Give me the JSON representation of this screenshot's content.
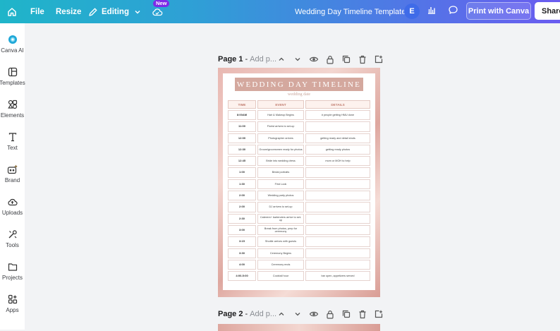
{
  "topbar": {
    "file_label": "File",
    "resize_label": "Resize",
    "editing_label": "Editing",
    "new_badge": "New",
    "doc_title": "Wedding Day Timeline Template",
    "avatar_initial": "E",
    "print_label": "Print with Canva",
    "share_label": "Share"
  },
  "sidebar": {
    "items": [
      {
        "label": "Canva AI",
        "icon": "canva-ai-icon"
      },
      {
        "label": "Templates",
        "icon": "templates-icon"
      },
      {
        "label": "Elements",
        "icon": "elements-icon"
      },
      {
        "label": "Text",
        "icon": "text-icon"
      },
      {
        "label": "Brand",
        "icon": "brand-icon"
      },
      {
        "label": "Uploads",
        "icon": "uploads-icon"
      },
      {
        "label": "Tools",
        "icon": "tools-icon"
      },
      {
        "label": "Projects",
        "icon": "projects-icon"
      },
      {
        "label": "Apps",
        "icon": "apps-icon"
      }
    ]
  },
  "pages": [
    {
      "title": "Page 1",
      "separator": "-",
      "placeholder": "Add p..."
    },
    {
      "title": "Page 2",
      "separator": "-",
      "placeholder": "Add p..."
    }
  ],
  "design": {
    "title": "WEDDING DAY TIMELINE",
    "subtitle": "wedding date",
    "headers": {
      "time": "TIME",
      "event": "EVENT",
      "details": "DETAILS"
    },
    "rows": [
      {
        "time": "8:00AM",
        "event": "Hair & Makeup Begins",
        "details": "# people getting HMU done"
      },
      {
        "time": "11:00",
        "event": "Florist arrives to set-up",
        "details": ""
      },
      {
        "time": "12:00",
        "event": "Photographer arrives",
        "details": "getting ready and detail shots"
      },
      {
        "time": "12:30",
        "event": "Groom/groomsmen ready for photos",
        "details": "getting ready photos"
      },
      {
        "time": "12:45",
        "event": "Bride into wedding dress",
        "details": "mom or MOH to help"
      },
      {
        "time": "1:00",
        "event": "Bridal portraits",
        "details": ""
      },
      {
        "time": "1:30",
        "event": "First Look",
        "details": ""
      },
      {
        "time": "2:00",
        "event": "Wedding party photos",
        "details": ""
      },
      {
        "time": "2:00",
        "event": "DJ arrives to set-up",
        "details": ""
      },
      {
        "time": "2:30",
        "event": "Caterers+ bartenders arrive to set-up",
        "details": ""
      },
      {
        "time": "3:00",
        "event": "Break from photos, prep for ceremony",
        "details": ""
      },
      {
        "time": "3:15",
        "event": "Shuttle arrives with guests",
        "details": ""
      },
      {
        "time": "3:30",
        "event": "Ceremony Begins",
        "details": ""
      },
      {
        "time": "4:00",
        "event": "Ceremony ends",
        "details": ""
      },
      {
        "time": "4:00-5:00",
        "event": "Cocktail hour",
        "details": "bar open, appetizers served"
      }
    ]
  },
  "colors": {
    "topbar_gradient_start": "#1fb5c9",
    "topbar_gradient_end": "#6a5cf0",
    "new_badge": "#7d2ae8",
    "avatar": "#3f6be8",
    "title_bar": "#d4a89e"
  }
}
